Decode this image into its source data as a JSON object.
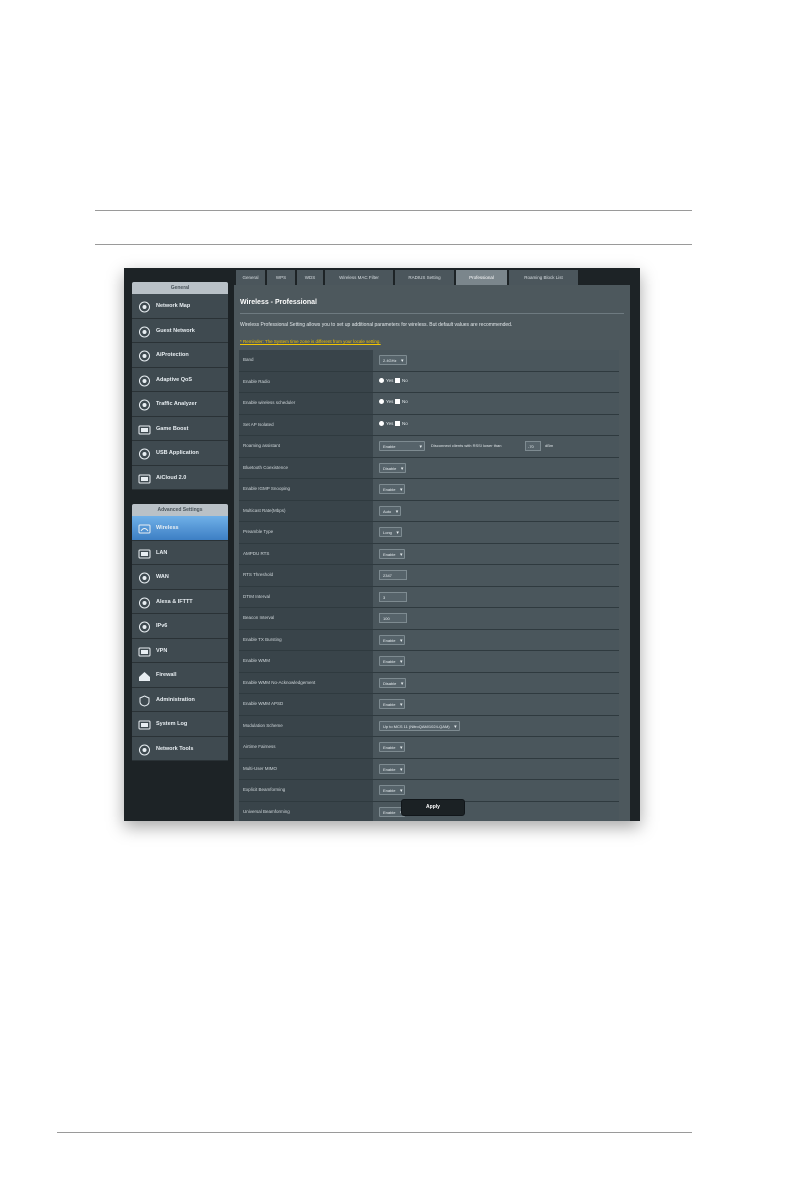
{
  "sidebar": {
    "general_header": "General",
    "general_items": [
      {
        "label": "Network Map",
        "icon": "network-map-icon"
      },
      {
        "label": "Guest Network",
        "icon": "guest-network-icon"
      },
      {
        "label": "AiProtection",
        "icon": "aiprotection-icon"
      },
      {
        "label": "Adaptive QoS",
        "icon": "adaptive-qos-icon"
      },
      {
        "label": "Traffic Analyzer",
        "icon": "traffic-analyzer-icon"
      },
      {
        "label": "Game Boost",
        "icon": "game-boost-icon"
      },
      {
        "label": "USB Application",
        "icon": "usb-application-icon"
      },
      {
        "label": "AiCloud 2.0",
        "icon": "aicloud-icon"
      }
    ],
    "advanced_header": "Advanced Settings",
    "advanced_items": [
      {
        "label": "Wireless",
        "icon": "wireless-icon"
      },
      {
        "label": "LAN",
        "icon": "lan-icon"
      },
      {
        "label": "WAN",
        "icon": "wan-icon"
      },
      {
        "label": "Alexa & IFTTT",
        "icon": "alexa-icon"
      },
      {
        "label": "IPv6",
        "icon": "ipv6-icon"
      },
      {
        "label": "VPN",
        "icon": "vpn-icon"
      },
      {
        "label": "Firewall",
        "icon": "firewall-icon"
      },
      {
        "label": "Administration",
        "icon": "administration-icon"
      },
      {
        "label": "System Log",
        "icon": "system-log-icon"
      },
      {
        "label": "Network Tools",
        "icon": "network-tools-icon"
      }
    ]
  },
  "tabs": [
    "General",
    "WPS",
    "WDS",
    "Wireless MAC Filter",
    "RADIUS Setting",
    "Professional",
    "Roaming Block List"
  ],
  "main": {
    "title": "Wireless - Professional",
    "description": "Wireless Professional Setting allows you to set up additional parameters for wireless. But default values are recommended.",
    "faq": "* Reminder: The System time zone is different from your locale setting.",
    "apply_label": "Apply"
  },
  "settings": [
    {
      "label": "Band",
      "type": "select",
      "value": "2.4GHz"
    },
    {
      "label": "Enable Radio",
      "type": "radio",
      "yes": "Yes",
      "no": "No"
    },
    {
      "label": "Enable wireless scheduler",
      "type": "radio",
      "yes": "Yes",
      "no": "No"
    },
    {
      "label": "Set AP Isolated",
      "type": "radio",
      "yes": "Yes",
      "no": "No"
    },
    {
      "label": "Roaming assistant",
      "type": "select",
      "value": "Enable",
      "extra": "Disconnect clients with RSSI lower than",
      "extra_value": "-70",
      "unit": "dBm"
    },
    {
      "label": "Bluetooth Coexistence",
      "type": "select",
      "value": "Disable"
    },
    {
      "label": "Enable IGMP Snooping",
      "type": "select",
      "value": "Enable"
    },
    {
      "label": "Multicast Rate(Mbps)",
      "type": "select",
      "value": "Auto"
    },
    {
      "label": "Preamble Type",
      "type": "select",
      "value": "Long"
    },
    {
      "label": "AMPDU RTS",
      "type": "select",
      "value": "Enable"
    },
    {
      "label": "RTS Threshold",
      "type": "text",
      "value": "2347"
    },
    {
      "label": "DTIM Interval",
      "type": "text",
      "value": "3"
    },
    {
      "label": "Beacon Interval",
      "type": "text",
      "value": "100"
    },
    {
      "label": "Enable TX Bursting",
      "type": "select",
      "value": "Enable"
    },
    {
      "label": "Enable WMM",
      "type": "select",
      "value": "Enable"
    },
    {
      "label": "Enable WMM No-Acknowledgement",
      "type": "select",
      "value": "Disable"
    },
    {
      "label": "Enable WMM APSD",
      "type": "select",
      "value": "Enable"
    },
    {
      "label": "Modulation Scheme",
      "type": "select",
      "value": "Up to MCS 11 (NitroQAM/1024-QAM)"
    },
    {
      "label": "Airtime Fairness",
      "type": "select",
      "value": "Enable"
    },
    {
      "label": "Multi-User MIMO",
      "type": "select",
      "value": "Enable"
    },
    {
      "label": "Explicit Beamforming",
      "type": "select",
      "value": "Enable"
    },
    {
      "label": "Universal Beamforming",
      "type": "select",
      "value": "Enable"
    }
  ]
}
